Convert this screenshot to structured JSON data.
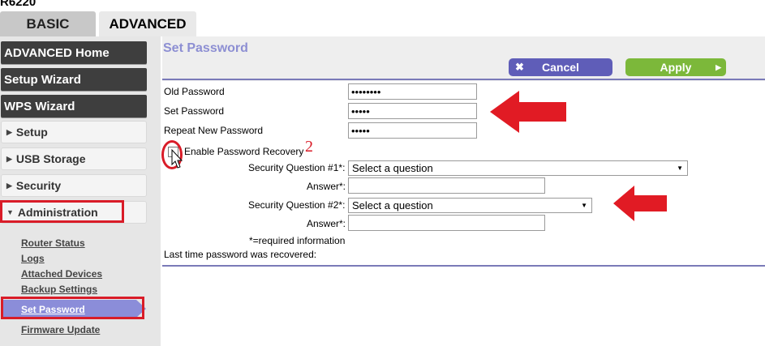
{
  "model": "R6220",
  "tabs": {
    "basic": "BASIC",
    "advanced": "ADVANCED"
  },
  "sidebar": {
    "dark_items": [
      "ADVANCED Home",
      "Setup Wizard",
      "WPS Wizard"
    ],
    "light_items": [
      "Setup",
      "USB Storage",
      "Security",
      "Administration"
    ],
    "sub_items": [
      "Router Status",
      "Logs",
      "Attached Devices",
      "Backup Settings",
      "Set Password",
      "Firmware Update"
    ],
    "active_sub_item": "Set Password"
  },
  "page": {
    "title": "Set Password",
    "cancel_label": "Cancel",
    "apply_label": "Apply"
  },
  "form": {
    "old_password_label": "Old Password",
    "old_password_value": "••••••••",
    "set_password_label": "Set Password",
    "set_password_value": "•••••",
    "repeat_password_label": "Repeat New Password",
    "repeat_password_value": "•••••",
    "enable_recovery_label": "Enable Password Recovery",
    "q1_label": "Security Question #1*:",
    "q1_value": "Select a question",
    "a1_label": "Answer*:",
    "q2_label": "Security Question #2*:",
    "q2_value": "Select a question",
    "a2_label": "Answer*:",
    "required_note": "*=required information",
    "last_recovered_label": "Last time password was recovered:"
  },
  "annotation_number": "2",
  "colors": {
    "accent": "#8d8fd3",
    "annotation_red": "#d91c28",
    "cancel": "#5f5db8",
    "apply": "#7cb83a"
  },
  "icons": [
    "close-icon",
    "arrow-right-icon",
    "chevron-down-icon",
    "cursor-icon"
  ]
}
